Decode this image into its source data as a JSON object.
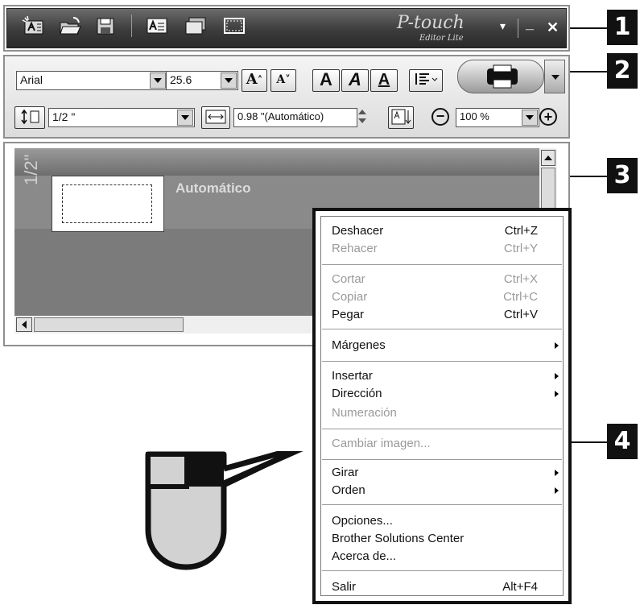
{
  "callouts": [
    "1",
    "2",
    "3",
    "4"
  ],
  "app": {
    "logo": "P-touch",
    "logo_sub": "Editor Lite",
    "menu_glyph": "▾",
    "minimize_glyph": "_",
    "close_glyph": "✕"
  },
  "propbar": {
    "font": "Arial",
    "size": "25.6",
    "length": "1/2 \"",
    "width_value": "0.98 \"(Automático)",
    "zoom": "100 %",
    "btn_grow": "A",
    "btn_shrink": "A",
    "btn_bold": "A",
    "btn_italic": "A",
    "btn_underline": "A",
    "zoom_out": "−",
    "zoom_in": "+"
  },
  "workspace": {
    "tape_width_label": "1/2\"",
    "label_mode": "Automático"
  },
  "menu": {
    "undo": "Deshacer",
    "undo_sc": "Ctrl+Z",
    "redo": "Rehacer",
    "redo_sc": "Ctrl+Y",
    "cut": "Cortar",
    "cut_sc": "Ctrl+X",
    "copy": "Copiar",
    "copy_sc": "Ctrl+C",
    "paste": "Pegar",
    "paste_sc": "Ctrl+V",
    "margins": "Márgenes",
    "insert": "Insertar",
    "direction": "Dirección",
    "numbering": "Numeración",
    "change_image": "Cambiar imagen...",
    "rotate": "Girar",
    "order": "Orden",
    "options": "Opciones...",
    "bsc": "Brother Solutions Center",
    "about": "Acerca de...",
    "exit": "Salir",
    "exit_sc": "Alt+F4"
  }
}
